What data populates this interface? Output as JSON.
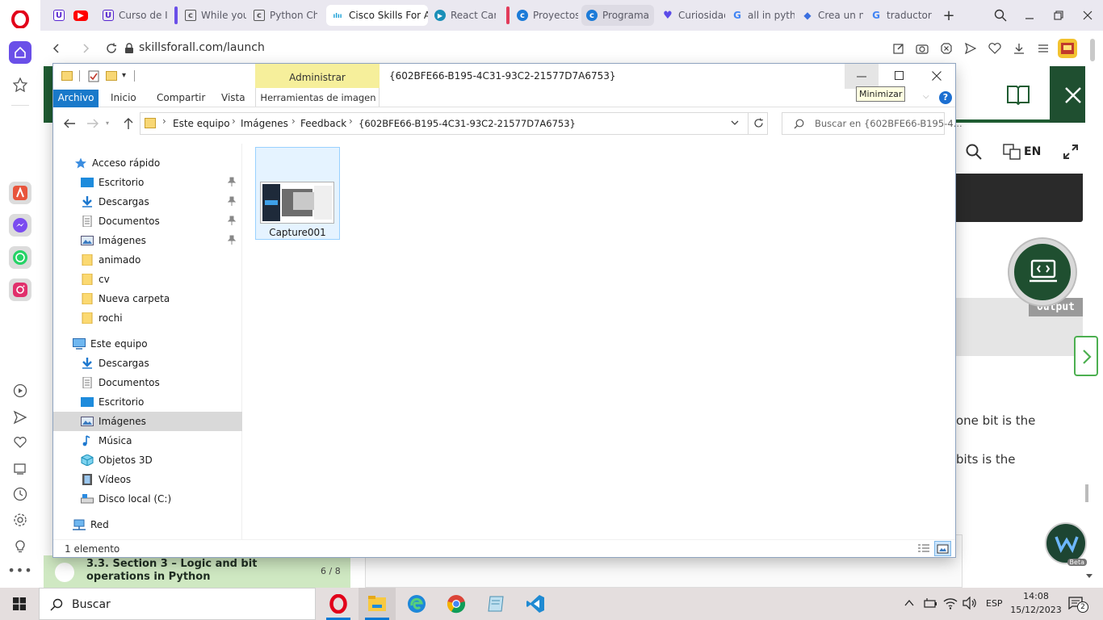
{
  "browser": {
    "tabs": [
      {
        "label": "",
        "favicon": "u-icon"
      },
      {
        "label": "",
        "favicon": "youtube-icon"
      },
      {
        "label": "Curso de I",
        "favicon": "u-icon"
      },
      {
        "label": "While you",
        "favicon": "c-doc-icon"
      },
      {
        "label": "Python Ch",
        "favicon": "c-doc-icon"
      },
      {
        "label": "Cisco Skills For All",
        "favicon": "cisco-icon"
      },
      {
        "label": "React Caro",
        "favicon": "react-icon"
      },
      {
        "label": "Proyectos",
        "favicon": "edge-c-icon"
      },
      {
        "label": "Programa",
        "favicon": "edge-c-icon"
      },
      {
        "label": "Curiosidad",
        "favicon": "heart-shield-icon"
      },
      {
        "label": "all in pytho",
        "favicon": "google-icon"
      },
      {
        "label": "Crea un nu",
        "favicon": "gemini-icon"
      },
      {
        "label": "traductor",
        "favicon": "google-icon"
      }
    ],
    "url": "skillsforall.com/launch"
  },
  "webpage": {
    "header_lang": "EN",
    "output_label": "Output",
    "text_line1": "one bit is the",
    "text_line2": "bits is the",
    "section_title": "3.3. Section 3 – Logic and bit operations in Python",
    "section_progress": "6 / 8",
    "bot_label": "Beta"
  },
  "explorer": {
    "title": "{602BFE66-B195-4C31-93C2-21577D7A6753}",
    "contextual_group": "Administrar",
    "ribbon_tabs": [
      "Archivo",
      "Inicio",
      "Compartir",
      "Vista",
      "Herramientas de imagen"
    ],
    "tooltip": "Minimizar",
    "breadcrumb": [
      "Este equipo",
      "Imágenes",
      "Feedback",
      "{602BFE66-B195-4C31-93C2-21577D7A6753}"
    ],
    "search_placeholder": "Buscar en {602BFE66-B195-4...",
    "nav_tree": [
      {
        "label": "Acceso rápido",
        "icon": "star-icon",
        "level": 0,
        "pinned": false
      },
      {
        "label": "Escritorio",
        "icon": "desktop-icon",
        "level": 1,
        "pinned": true
      },
      {
        "label": "Descargas",
        "icon": "download-icon",
        "level": 1,
        "pinned": true
      },
      {
        "label": "Documentos",
        "icon": "documents-icon",
        "level": 1,
        "pinned": true
      },
      {
        "label": "Imágenes",
        "icon": "pictures-icon",
        "level": 1,
        "pinned": true
      },
      {
        "label": "animado",
        "icon": "folder-icon",
        "level": 1,
        "pinned": false
      },
      {
        "label": "cv",
        "icon": "folder-icon",
        "level": 1,
        "pinned": false
      },
      {
        "label": "Nueva carpeta",
        "icon": "folder-icon",
        "level": 1,
        "pinned": false
      },
      {
        "label": "rochi",
        "icon": "folder-icon",
        "level": 1,
        "pinned": false
      },
      {
        "label": "Este equipo",
        "icon": "computer-icon",
        "level": 0,
        "pinned": false
      },
      {
        "label": "Descargas",
        "icon": "download-icon",
        "level": 1,
        "pinned": false
      },
      {
        "label": "Documentos",
        "icon": "documents-icon",
        "level": 1,
        "pinned": false
      },
      {
        "label": "Escritorio",
        "icon": "desktop-icon",
        "level": 1,
        "pinned": false
      },
      {
        "label": "Imágenes",
        "icon": "pictures-icon",
        "level": 1,
        "pinned": false,
        "selected": true
      },
      {
        "label": "Música",
        "icon": "music-icon",
        "level": 1,
        "pinned": false
      },
      {
        "label": "Objetos 3D",
        "icon": "3d-objects-icon",
        "level": 1,
        "pinned": false
      },
      {
        "label": "Vídeos",
        "icon": "videos-icon",
        "level": 1,
        "pinned": false
      },
      {
        "label": "Disco local (C:)",
        "icon": "drive-icon",
        "level": 1,
        "pinned": false
      },
      {
        "label": "Red",
        "icon": "network-icon",
        "level": 0,
        "pinned": false
      }
    ],
    "files": [
      {
        "name": "Capture001",
        "type": "image"
      }
    ],
    "status_text": "1 elemento"
  },
  "taskbar": {
    "search_placeholder": "Buscar",
    "lang": "ESP",
    "time": "14:08",
    "date": "15/12/2023",
    "notifications": "2"
  },
  "colors": {
    "opera_red": "#e2001a",
    "accent_blue": "#1a73e8",
    "ribbon_file_blue": "#1979ca",
    "contextual_yellow": "#f6ef9b",
    "web_green": "#1f5c32",
    "selection_gray": "#d9d9d9"
  }
}
